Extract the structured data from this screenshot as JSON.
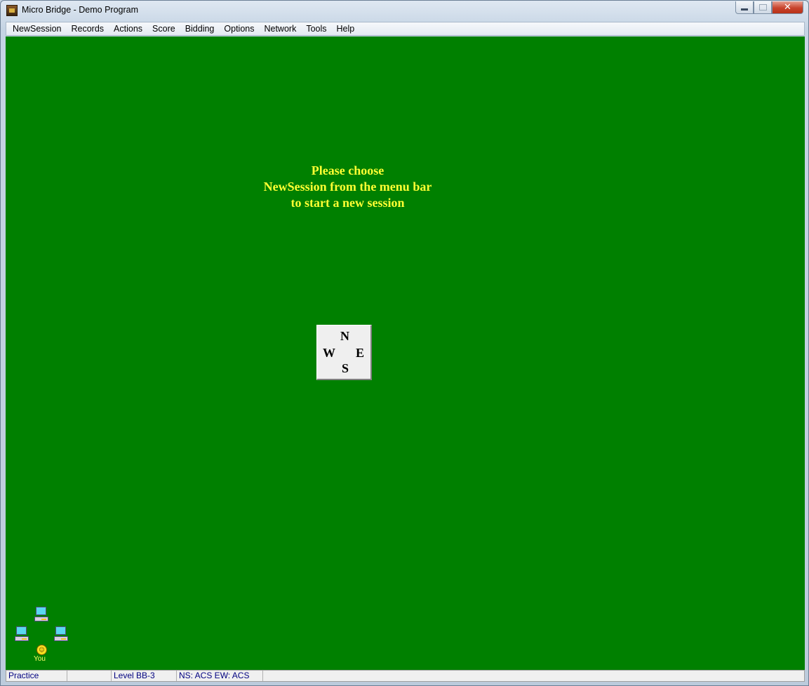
{
  "window": {
    "title": "Micro Bridge - Demo Program",
    "app_icon": "bridge-app-icon",
    "controls": {
      "minimize": "minimize-icon",
      "maximize": "maximize-icon",
      "close": "✕"
    }
  },
  "menubar": {
    "items": [
      {
        "label": "NewSession"
      },
      {
        "label": "Records"
      },
      {
        "label": "Actions"
      },
      {
        "label": "Score"
      },
      {
        "label": "Bidding"
      },
      {
        "label": "Options"
      },
      {
        "label": "Network"
      },
      {
        "label": "Tools"
      },
      {
        "label": "Help"
      }
    ]
  },
  "table": {
    "background": "#008000",
    "prompt_lines": [
      "Please choose",
      "NewSession from the menu bar",
      "to start a new session"
    ],
    "prompt_color": "#ffff33",
    "compass": {
      "north": "N",
      "west": "W",
      "east": "E",
      "south": "S"
    },
    "players": {
      "you_label": "You",
      "you_icon": "☺"
    }
  },
  "statusbar": {
    "cells": [
      "Practice",
      "",
      "Level BB-3",
      "NS: ACS  EW: ACS",
      ""
    ]
  }
}
